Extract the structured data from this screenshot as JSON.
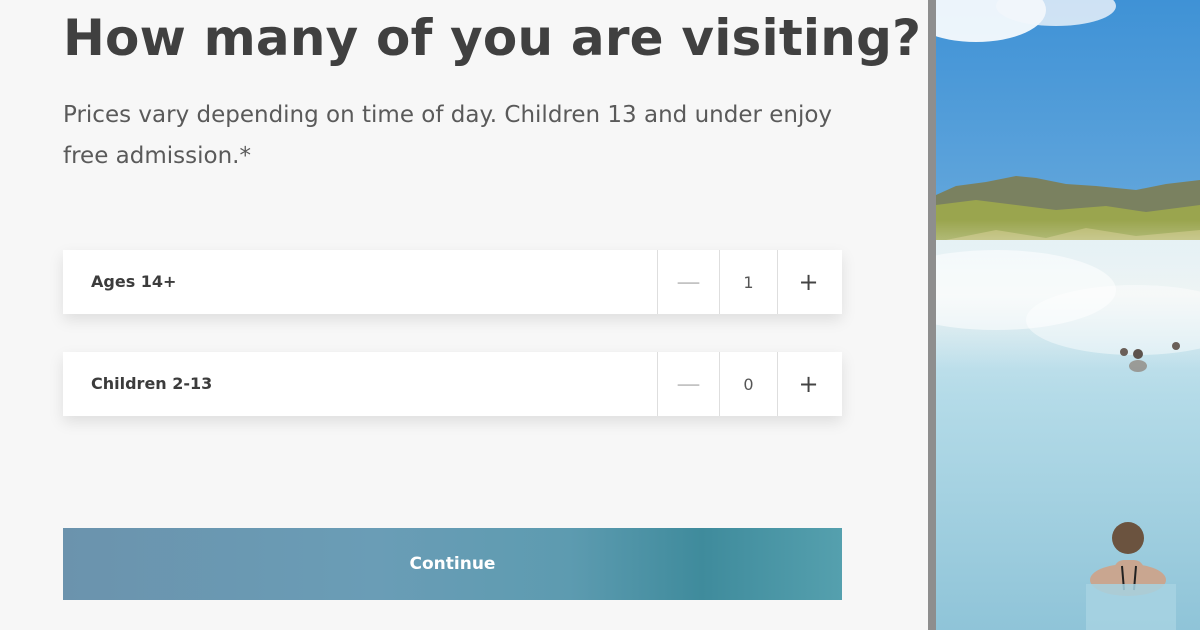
{
  "heading": "How many of you are visiting?",
  "subtext": "Prices vary depending on time of day. Children 13 and under enjoy free admission.*",
  "guests": [
    {
      "label": "Ages 14+",
      "count": "1",
      "minus": "—",
      "plus": "+"
    },
    {
      "label": "Children 2-13",
      "count": "0",
      "minus": "—",
      "plus": "+"
    }
  ],
  "continue_label": "Continue",
  "colors": {
    "button_gradient_start": "#6b93ad",
    "button_gradient_end": "#55a0ae",
    "page_background": "#f7f7f7",
    "divider": "#8e8e8e"
  }
}
